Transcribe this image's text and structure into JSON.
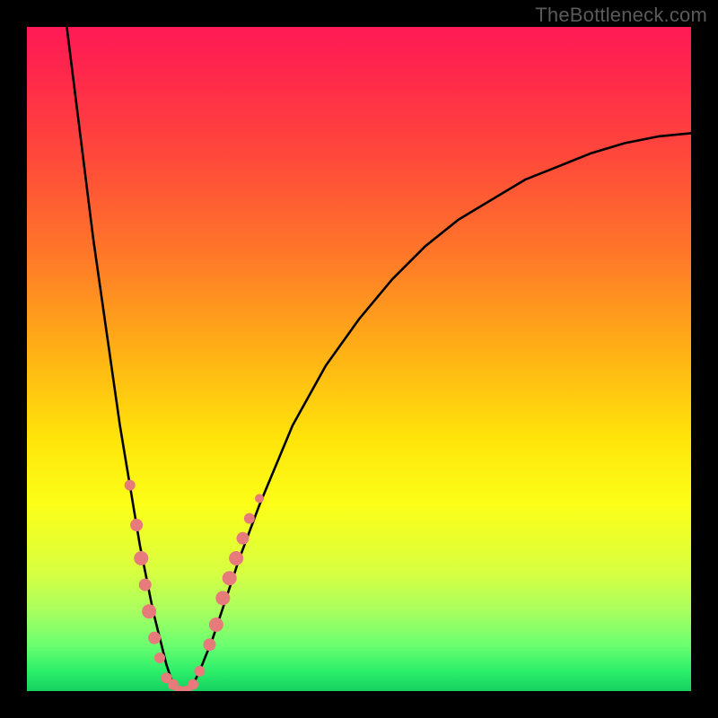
{
  "watermark": "TheBottleneck.com",
  "chart_data": {
    "type": "line",
    "title": "",
    "xlabel": "",
    "ylabel": "",
    "xlim": [
      0,
      100
    ],
    "ylim": [
      0,
      100
    ],
    "grid": false,
    "background": "heat-gradient",
    "series": [
      {
        "name": "bottleneck-curve",
        "x": [
          6,
          7,
          8,
          9,
          10,
          11,
          12,
          13,
          14,
          15,
          16,
          17,
          18,
          19,
          20,
          21,
          22,
          23,
          24,
          25,
          26,
          28,
          30,
          32,
          35,
          40,
          45,
          50,
          55,
          60,
          65,
          70,
          75,
          80,
          85,
          90,
          95,
          100
        ],
        "values": [
          100,
          92,
          84,
          76,
          68,
          61,
          54,
          47,
          40,
          34,
          28,
          22,
          17,
          12,
          8,
          4,
          1,
          0,
          0,
          1,
          3,
          8,
          14,
          20,
          28,
          40,
          49,
          56,
          62,
          67,
          71,
          74,
          77,
          79,
          81,
          82.5,
          83.5,
          84
        ]
      }
    ],
    "markers": {
      "name": "highlight-dots",
      "color": "#e77a7a",
      "points": [
        {
          "x": 15.5,
          "y": 31,
          "r": 6
        },
        {
          "x": 16.5,
          "y": 25,
          "r": 7
        },
        {
          "x": 17.2,
          "y": 20,
          "r": 8
        },
        {
          "x": 17.8,
          "y": 16,
          "r": 7
        },
        {
          "x": 18.4,
          "y": 12,
          "r": 8
        },
        {
          "x": 19.2,
          "y": 8,
          "r": 7
        },
        {
          "x": 20.0,
          "y": 5,
          "r": 6
        },
        {
          "x": 21.0,
          "y": 2,
          "r": 6
        },
        {
          "x": 22.0,
          "y": 1,
          "r": 6
        },
        {
          "x": 23.0,
          "y": 0,
          "r": 6
        },
        {
          "x": 24.0,
          "y": 0,
          "r": 6
        },
        {
          "x": 25.0,
          "y": 1,
          "r": 6
        },
        {
          "x": 26.0,
          "y": 3,
          "r": 6
        },
        {
          "x": 27.5,
          "y": 7,
          "r": 7
        },
        {
          "x": 28.5,
          "y": 10,
          "r": 8
        },
        {
          "x": 29.5,
          "y": 14,
          "r": 8
        },
        {
          "x": 30.5,
          "y": 17,
          "r": 8
        },
        {
          "x": 31.5,
          "y": 20,
          "r": 8
        },
        {
          "x": 32.5,
          "y": 23,
          "r": 7
        },
        {
          "x": 33.5,
          "y": 26,
          "r": 6
        },
        {
          "x": 35.0,
          "y": 29,
          "r": 5
        }
      ]
    }
  }
}
